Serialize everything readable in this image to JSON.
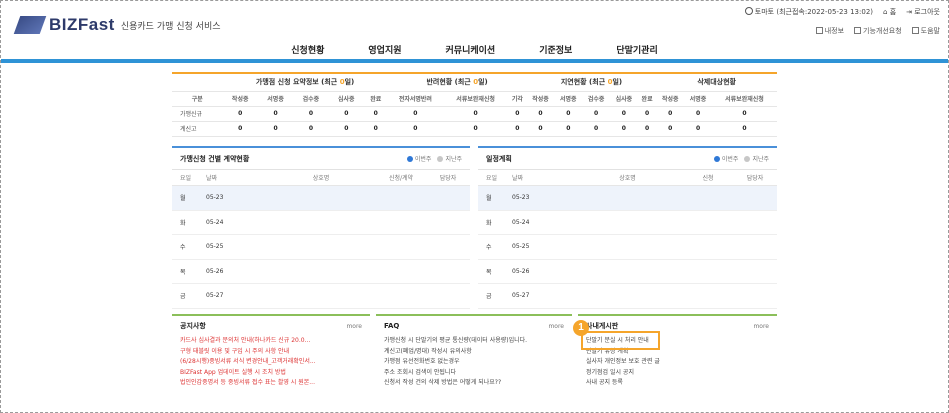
{
  "brand": {
    "logo": "BIZFast",
    "subtitle": "신용카드 가맹 신청 서비스"
  },
  "util": {
    "user": "토마토 (최근접속:2022-05-23 13:02)",
    "home": "홈",
    "logout": "로그아웃"
  },
  "util2": {
    "myinfo": "내정보",
    "request": "기능개선요청",
    "help": "도움말"
  },
  "gnb": [
    "신청현황",
    "영업지원",
    "커뮤니케이션",
    "기준정보",
    "단말기관리"
  ],
  "summary": {
    "groups": [
      {
        "label": "가맹점 신청 요약정보 (최근 ",
        "hl": "0",
        "tail": "일)"
      },
      {
        "label": "반려현황 (최근 ",
        "hl": "0",
        "tail": "일)"
      },
      {
        "label": "지연현황 (최근 ",
        "hl": "0",
        "tail": "일)"
      },
      {
        "label": "삭제대상현황",
        "hl": "",
        "tail": ""
      }
    ],
    "cols": [
      "구분",
      "작성중",
      "서명중",
      "검수중",
      "심사중",
      "완료",
      "전자서명반려",
      "서류보완재신청",
      "기각",
      "작성중",
      "서명중",
      "검수중",
      "심사중",
      "완료",
      "작성중",
      "서명중",
      "서류보완재신청"
    ],
    "rows": [
      {
        "label": "가맹신규",
        "vals": [
          "0",
          "0",
          "0",
          "0",
          "0",
          "0",
          "0",
          "0",
          "0",
          "0",
          "0",
          "0",
          "0",
          "0",
          "0",
          "0"
        ]
      },
      {
        "label": "계신고",
        "vals": [
          "0",
          "0",
          "0",
          "0",
          "0",
          "0",
          "0",
          "0",
          "0",
          "0",
          "0",
          "0",
          "0",
          "0",
          "0",
          "0"
        ]
      }
    ]
  },
  "contract": {
    "title": "가맹신청 건별 계약현황",
    "radio_on": "이번주",
    "radio_off": "지난주",
    "headers": [
      "요일",
      "날짜",
      "상호명",
      "신청/계약",
      "담당자"
    ],
    "rows": [
      {
        "day": "월",
        "date": "05-23"
      },
      {
        "day": "화",
        "date": "05-24"
      },
      {
        "day": "수",
        "date": "05-25"
      },
      {
        "day": "목",
        "date": "05-26"
      },
      {
        "day": "금",
        "date": "05-27"
      }
    ]
  },
  "schedule": {
    "title": "일정계획",
    "radio_on": "이번주",
    "radio_off": "지난주",
    "headers": [
      "요일",
      "날짜",
      "상호명",
      "신청",
      "담당자"
    ],
    "rows": [
      {
        "day": "월",
        "date": "05-23"
      },
      {
        "day": "화",
        "date": "05-24"
      },
      {
        "day": "수",
        "date": "05-25"
      },
      {
        "day": "목",
        "date": "05-26"
      },
      {
        "day": "금",
        "date": "05-27"
      }
    ]
  },
  "notice": {
    "title": "공지사항",
    "more": "more",
    "items": [
      "카드사 심사결과 문의처 안내(하나카드 신규 20.0...",
      "구형 태블릿 이용 및 구입 시 주의 사항 안내",
      "(6/28시행)중빙서류 서식 변경안내_고객거래확인서...",
      "BIZFast App 업데이트 실행 시 조치 방법",
      "법인인감중명서 등 중빙서류 접수 표는 촬영 시 원본..."
    ]
  },
  "faq": {
    "title": "FAQ",
    "more": "more",
    "items": [
      "가맹신청 시 단말기의 평균 통신량(데이터 사용량)입니다.",
      "계신고(폐업/명대) 작성시 유의사항",
      "가맹점 유선전화번호 없는경우",
      "주소 조회시 검색이 안됩니다",
      "신청서 작성 건의 삭제 방법은 어떻게 되나요??"
    ]
  },
  "internal": {
    "title": "사내게시판",
    "more": "more",
    "items": [
      "단말기 분실 시 처리 안내",
      "단말기 유상 계획",
      "실사자 개인정보 보호 관련 글",
      "정기점검 일시 공지",
      "사내 공지 등록"
    ]
  },
  "callout": {
    "badge": "1"
  },
  "colors": {
    "accent_blue": "#2f93d6",
    "orange": "#f5a52b",
    "green": "#8bbf5a"
  }
}
